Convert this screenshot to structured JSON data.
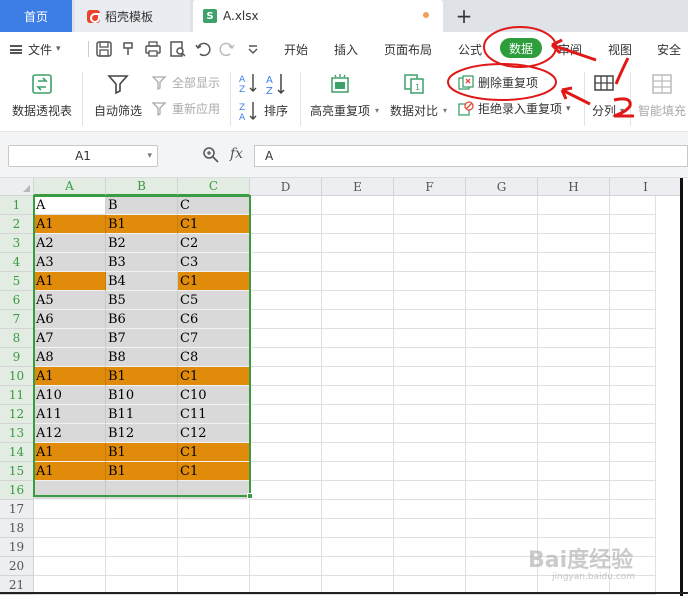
{
  "tabs": {
    "home": "首页",
    "docer": "稻壳模板",
    "file": "A.xlsx",
    "file_icon_letter": "S",
    "new_tab": "+"
  },
  "menu": {
    "file": "文件",
    "items": [
      "开始",
      "插入",
      "页面布局",
      "公式",
      "数据",
      "审阅",
      "视图",
      "安全"
    ],
    "active": "数据"
  },
  "ribbon": {
    "pivot": "数据透视表",
    "autofilter": "自动筛选",
    "show_all": "全部显示",
    "reapply": "重新应用",
    "sort": "排序",
    "highlight_dup": "高亮重复项",
    "compare": "数据对比",
    "remove_dup": "删除重复项",
    "reject_dup": "拒绝录入重复项",
    "split": "分列",
    "smart_fill": "智能填充"
  },
  "formula_bar": {
    "name_box": "A1",
    "fx": "fx",
    "content": "A"
  },
  "sheet": {
    "columns": [
      "A",
      "B",
      "C",
      "D",
      "E",
      "F",
      "G",
      "H",
      "I"
    ],
    "rows": [
      "1",
      "2",
      "3",
      "4",
      "5",
      "6",
      "7",
      "8",
      "9",
      "10",
      "11",
      "12",
      "13",
      "14",
      "15",
      "16",
      "17",
      "18",
      "19",
      "20",
      "21"
    ],
    "data": [
      [
        "A",
        "B",
        "C"
      ],
      [
        "A1",
        "B1",
        "C1"
      ],
      [
        "A2",
        "B2",
        "C2"
      ],
      [
        "A3",
        "B3",
        "C3"
      ],
      [
        "A1",
        "B4",
        "C1"
      ],
      [
        "A5",
        "B5",
        "C5"
      ],
      [
        "A6",
        "B6",
        "C6"
      ],
      [
        "A7",
        "B7",
        "C7"
      ],
      [
        "A8",
        "B8",
        "C8"
      ],
      [
        "A1",
        "B1",
        "C1"
      ],
      [
        "A10",
        "B10",
        "C10"
      ],
      [
        "A11",
        "B11",
        "C11"
      ],
      [
        "A12",
        "B12",
        "C12"
      ],
      [
        "A1",
        "B1",
        "C1"
      ],
      [
        "A1",
        "B1",
        "C1"
      ],
      [
        "",
        "",
        ""
      ]
    ],
    "highlight_color": "#e18b0b",
    "selection_color": "#3a9b40"
  },
  "annotations": {
    "step1": "1",
    "step2": "2"
  },
  "watermark": {
    "main": "Bai度经验",
    "sub": "jingyan.baidu.com"
  }
}
